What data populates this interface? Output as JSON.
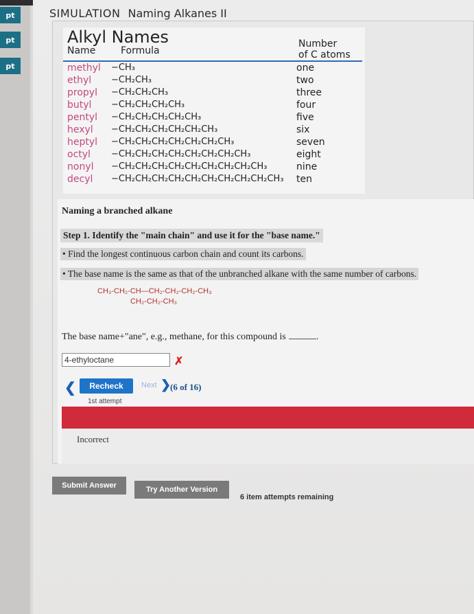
{
  "sidebar": {
    "badges": [
      "pt",
      "pt",
      "pt"
    ]
  },
  "header": {
    "sim_label": "SIMULATION",
    "title": "Naming Alkanes II"
  },
  "alkyl_table": {
    "title": "Alkyl Names",
    "col_name": "Name",
    "col_formula": "Formula",
    "col_number_line1": "Number",
    "col_number_line2": "of C atoms",
    "rows": [
      {
        "name": "methyl",
        "formula": "−CH₃",
        "number": "one"
      },
      {
        "name": "ethyl",
        "formula": "−CH₂CH₃",
        "number": "two"
      },
      {
        "name": "propyl",
        "formula": "−CH₂CH₂CH₃",
        "number": "three"
      },
      {
        "name": "butyl",
        "formula": "−CH₂CH₂CH₂CH₃",
        "number": "four"
      },
      {
        "name": "pentyl",
        "formula": "−CH₂CH₂CH₂CH₂CH₃",
        "number": "five"
      },
      {
        "name": "hexyl",
        "formula": "−CH₂CH₂CH₂CH₂CH₂CH₃",
        "number": "six"
      },
      {
        "name": "heptyl",
        "formula": "−CH₂CH₂CH₂CH₂CH₂CH₂CH₃",
        "number": "seven"
      },
      {
        "name": "octyl",
        "formula": "−CH₂CH₂CH₂CH₂CH₂CH₂CH₂CH₃",
        "number": "eight"
      },
      {
        "name": "nonyl",
        "formula": "−CH₂CH₂CH₂CH₂CH₂CH₂CH₂CH₂CH₃",
        "number": "nine"
      },
      {
        "name": "decyl",
        "formula": "−CH₂CH₂CH₂CH₂CH₂CH₂CH₂CH₂CH₂CH₃",
        "number": "ten"
      }
    ]
  },
  "content": {
    "subheading": "Naming a branched alkane",
    "step1": "Step 1. Identify the \"main chain\" and use it for the \"base name.\"",
    "bullet1": "• Find the longest continuous carbon chain and count its carbons.",
    "bullet2": "• The base name is the same as that of the unbranched alkane with the same number of carbons.",
    "formula_main": "CH₃-CH₂-CH—CH₂-CH₂-CH₂-CH₃",
    "formula_branch": "CH₂-CH₂-CH₃",
    "question": "The base name+\"ane\", e.g., methane, for this compound is",
    "question_end": ".",
    "answer_value": "4-ethyloctane",
    "wrong_mark": "✗",
    "back_chevron": "❮",
    "recheck_label": "Recheck",
    "next_label": "Next",
    "next_chevron": "❯",
    "progress": "(6 of 16)",
    "attempt": "1st attempt",
    "feedback": "Incorrect"
  },
  "footer": {
    "submit_label": "Submit Answer",
    "try_another_label": "Try Another Version",
    "remaining": "6 item attempts remaining"
  },
  "colors": {
    "accent": "#1e74c8",
    "error": "#d12a3a",
    "alkyl_name": "#c4477f",
    "badge": "#1d6f86"
  }
}
